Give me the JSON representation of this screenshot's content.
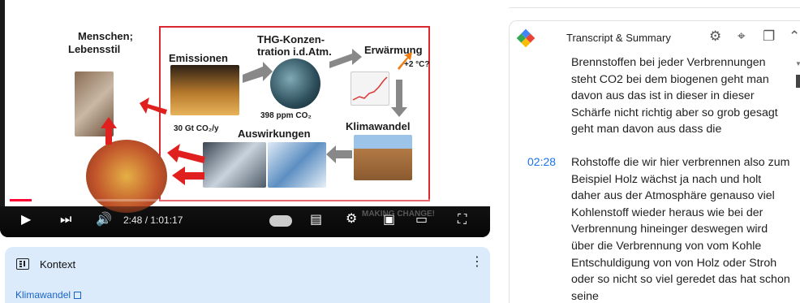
{
  "video": {
    "slide": {
      "label_people": "Menschen;",
      "label_people_2": "Lebensstil",
      "label_emissions": "Emissionen",
      "label_emissions_value": "30 Gt CO₂/y",
      "label_ghg": "THG-Konzen-",
      "label_ghg_2": "tration i.d.Atm.",
      "label_ghg_value": "398 ppm CO₂",
      "label_warming": "Erwärmung",
      "label_warming_value": "+2 °C?",
      "label_climate_change": "Klimawandel",
      "label_impacts": "Auswirkungen"
    },
    "controls": {
      "time": "2:48 / 1:01:17",
      "progress": 0.046,
      "watermark": "MAKING CHANGE!"
    }
  },
  "context": {
    "title": "Kontext",
    "link": "Klimawandel"
  },
  "panel": {
    "title": "Transcript & Summary",
    "segments": [
      {
        "time": "",
        "text": "Brennstoffen bei jeder Verbrennungen steht CO2 bei dem biogenen geht man davon aus das ist in dieser in dieser Schärfe nicht richtig aber so grob gesagt geht man davon aus dass die"
      },
      {
        "time": "02:28",
        "text": "Rohstoffe die wir hier verbrennen also zum Beispiel Holz wächst ja nach und holt daher aus der Atmosphäre genauso viel Kohlenstoff wieder heraus wie bei der Verbrennung hineinger deswegen wird über die Verbrennung von vom Kohle Entschuldigung von von Holz oder Stroh oder so nicht so viel geredet das hat schon seine"
      }
    ]
  },
  "colors": {
    "accent_red": "#d9282f",
    "link_blue": "#1a73e8",
    "context_bg": "#dcebfb",
    "progress_red": "#ff0033"
  }
}
